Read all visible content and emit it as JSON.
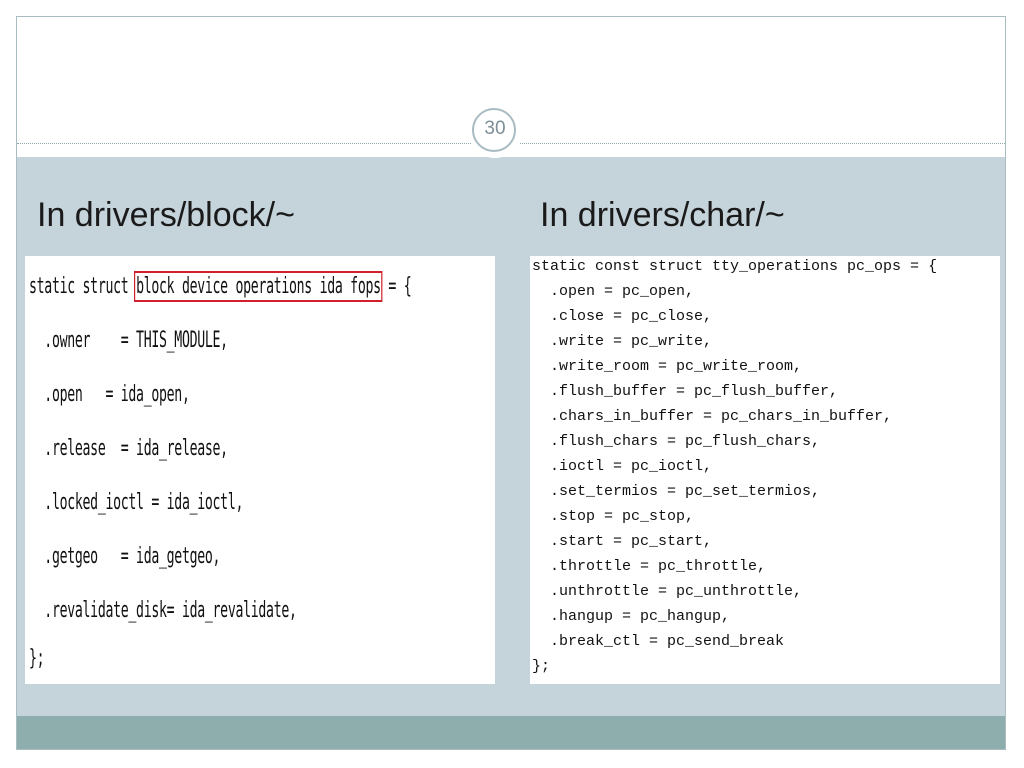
{
  "slide": {
    "page_number": "30",
    "heading_left": "In drivers/block/~",
    "heading_right": "In drivers/char/~"
  },
  "code_left": {
    "first_line_prefix": "static struct ",
    "highlighted_text": "block device operations ida fops",
    "first_line_suffix": " = {",
    "lines": [
      "  .owner    = THIS_MODULE,",
      "  .open   = ida_open,",
      "  .release  = ida_release,",
      "  .locked_ioctl = ida_ioctl,",
      "  .getgeo   = ida_getgeo,",
      "  .revalidate_disk= ida_revalidate,",
      "};"
    ],
    "highlight_color": "#d0202a"
  },
  "code_right": {
    "lines": [
      "static const struct tty_operations pc_ops = {",
      "  .open = pc_open,",
      "  .close = pc_close,",
      "  .write = pc_write,",
      "  .write_room = pc_write_room,",
      "  .flush_buffer = pc_flush_buffer,",
      "  .chars_in_buffer = pc_chars_in_buffer,",
      "  .flush_chars = pc_flush_chars,",
      "  .ioctl = pc_ioctl,",
      "  .set_termios = pc_set_termios,",
      "  .stop = pc_stop,",
      "  .start = pc_start,",
      "  .throttle = pc_throttle,",
      "  .unthrottle = pc_unthrottle,",
      "  .hangup = pc_hangup,",
      "  .break_ctl = pc_send_break",
      "};"
    ]
  },
  "colors": {
    "content_background": "#c5d3da",
    "bottom_band": "#8eadad",
    "frame_border": "#a9bcc2"
  }
}
